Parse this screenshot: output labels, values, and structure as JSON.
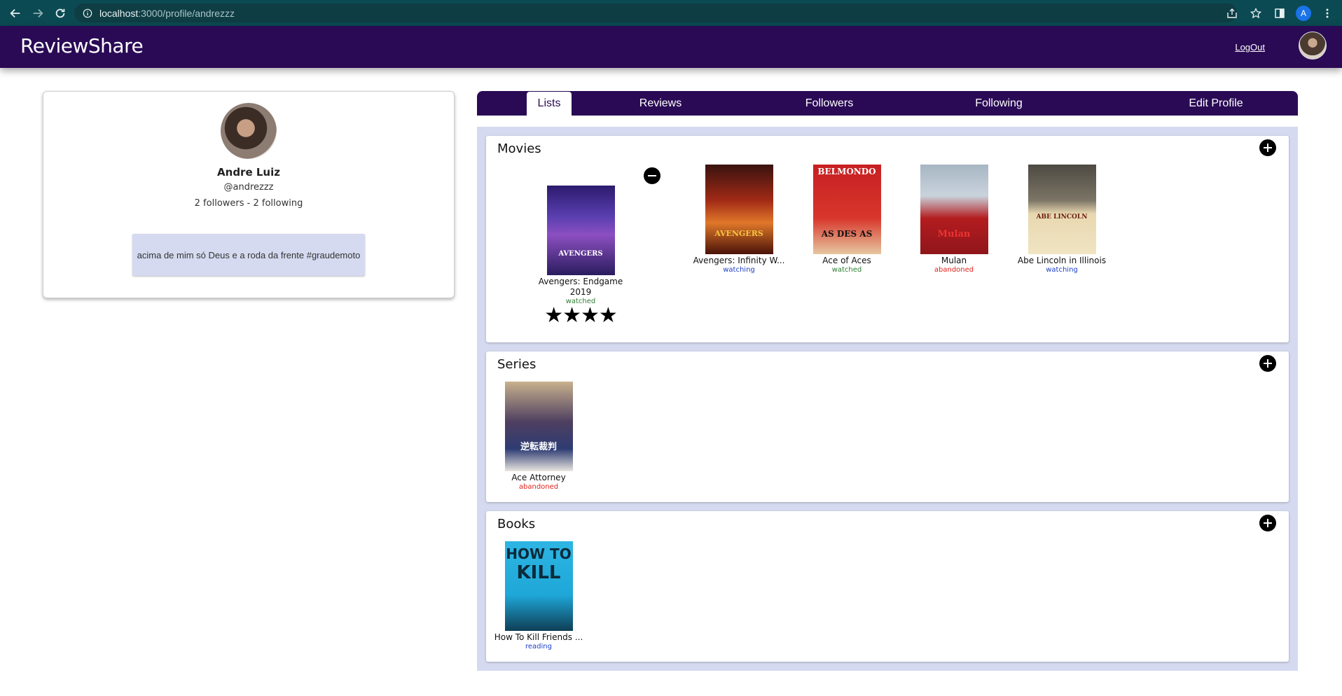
{
  "browser": {
    "url_host": "localhost",
    "url_path": ":3000/profile/andrezzz",
    "profile_initial": "A"
  },
  "header": {
    "brand": "ReviewShare",
    "logout_label": "LogOut"
  },
  "profile": {
    "name": "Andre Luiz",
    "username": "@andrezzz",
    "follow_summary": "2 followers - 2 following",
    "bio": "acima de mim só Deus e a roda da frente #graudemoto"
  },
  "tabs": [
    {
      "label": "Lists",
      "active": true
    },
    {
      "label": "Reviews",
      "active": false
    },
    {
      "label": "Followers",
      "active": false
    },
    {
      "label": "Following",
      "active": false
    },
    {
      "label": "Edit Profile",
      "active": false
    }
  ],
  "lists": {
    "movies": {
      "title": "Movies",
      "items": [
        {
          "title": "Avengers: Endgame",
          "year": "2019",
          "status": "watched",
          "stars": "★★★★",
          "rating": 4,
          "expanded": true
        },
        {
          "title": "Avengers: Infinity W...",
          "status": "watching"
        },
        {
          "title": "Ace of Aces",
          "status": "watched"
        },
        {
          "title": "Mulan",
          "status": "abandoned"
        },
        {
          "title": "Abe Lincoln in Illinois",
          "status": "watching"
        }
      ]
    },
    "series": {
      "title": "Series",
      "items": [
        {
          "title": "Ace Attorney",
          "status": "abandoned"
        }
      ]
    },
    "books": {
      "title": "Books",
      "items": [
        {
          "title": "How To Kill Friends ...",
          "status": "reading"
        }
      ]
    }
  },
  "colors": {
    "header_bg": "#2a0a55",
    "lists_bg": "#d5daf0",
    "watched": "#2e7d32",
    "watching": "#1e40c8",
    "abandoned": "#e0231d"
  }
}
